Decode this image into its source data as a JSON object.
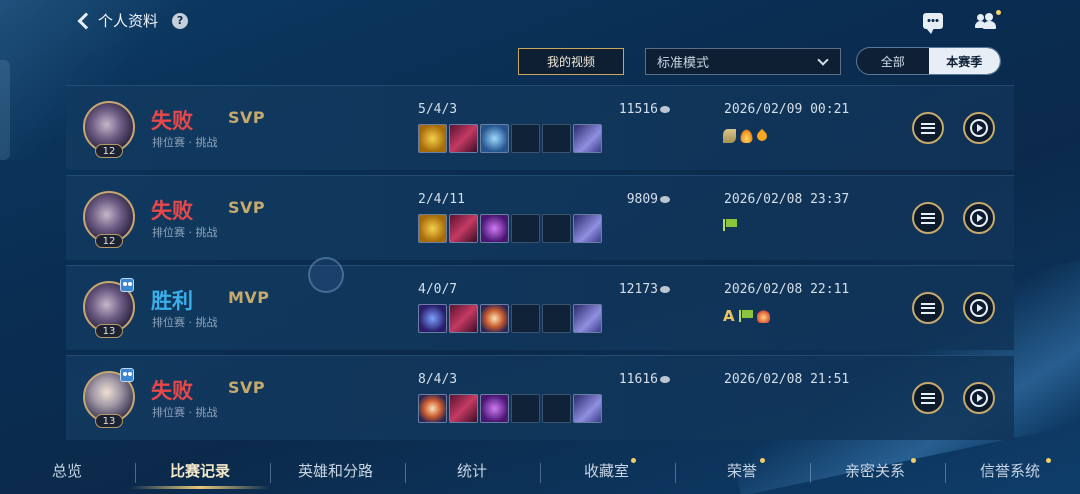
{
  "header": {
    "back_label": "个人资料",
    "help_symbol": "?"
  },
  "filters": {
    "video_button": "我的视频",
    "mode_select": "标准模式",
    "season_all": "全部",
    "season_current": "本赛季"
  },
  "matches": [
    {
      "level": "12",
      "result": "失败",
      "badge": "SVP",
      "mode": "排位赛 · 挑战",
      "kda": "5/4/3",
      "gold": "11516",
      "datetime": "2026/02/09 00:21",
      "items": [
        "gold-item",
        "red-item",
        "blue-item",
        "empty",
        "empty",
        "boot-item"
      ],
      "tags": [
        "sprout-icon",
        "flame-icon",
        "drop-icon"
      ]
    },
    {
      "level": "12",
      "result": "失败",
      "badge": "SVP",
      "mode": "排位赛 · 挑战",
      "kda": "2/4/11",
      "gold": "9809",
      "datetime": "2026/02/08 23:37",
      "items": [
        "gold-item",
        "red-item",
        "purple-item",
        "empty",
        "empty",
        "boot-item"
      ],
      "tags": [
        "flag-icon"
      ]
    },
    {
      "level": "13",
      "result": "胜利",
      "badge": "MVP",
      "mode": "排位赛 · 挑战",
      "kda": "4/0/7",
      "gold": "12173",
      "datetime": "2026/02/08 22:11",
      "items": [
        "void-item",
        "red-item",
        "orb-item",
        "empty",
        "empty",
        "boot-item"
      ],
      "tags": [
        "a-grade-icon",
        "flag-icon",
        "crown-icon"
      ],
      "tag_a_text": "A"
    },
    {
      "level": "13",
      "result": "失败",
      "badge": "SVP",
      "mode": "排位赛 · 挑战",
      "kda": "8/4/3",
      "gold": "11616",
      "datetime": "2026/02/08 21:51",
      "items": [
        "orb-item",
        "red-item",
        "purple-item",
        "empty",
        "empty",
        "boot-item"
      ],
      "tags": []
    }
  ],
  "bottom_nav": [
    "总览",
    "比赛记录",
    "英雄和分路",
    "统计",
    "收藏室",
    "荣誉",
    "亲密关系",
    "信誉系统"
  ],
  "colors": {
    "lose": "#e8484a",
    "win": "#3aaee8",
    "gold_accent": "#c6a96b"
  }
}
